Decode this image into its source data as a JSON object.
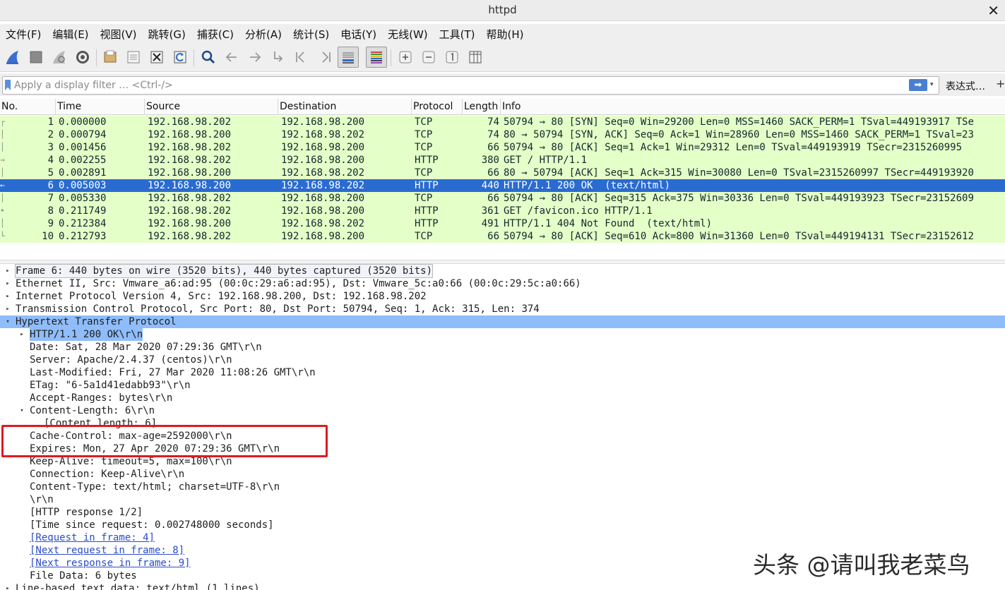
{
  "window": {
    "title": "httpd",
    "close_glyph": "✕"
  },
  "menu": [
    "文件(F)",
    "编辑(E)",
    "视图(V)",
    "跳转(G)",
    "捕获(C)",
    "分析(A)",
    "统计(S)",
    "电话(Y)",
    "无线(W)",
    "工具(T)",
    "帮助(H)"
  ],
  "toolbar": {
    "icons": [
      "shark-fin-start-icon",
      "stop-capture-icon",
      "restart-capture-icon",
      "capture-options-gear-icon",
      "open-file-icon",
      "save-file-icon",
      "close-file-icon",
      "reload-file-icon",
      "find-packet-icon",
      "go-back-icon",
      "go-forward-icon",
      "go-to-packet-icon",
      "first-packet-icon",
      "last-packet-icon",
      "auto-scroll-icon",
      "colorize-icon",
      "zoom-in-icon",
      "zoom-out-icon",
      "normal-size-icon",
      "resize-columns-icon"
    ],
    "pressed": [
      "auto-scroll-icon",
      "colorize-icon"
    ]
  },
  "filter": {
    "placeholder": "Apply a display filter … <Ctrl-/>",
    "value": "",
    "apply_glyph": "➡",
    "dropdown_glyph": "▾",
    "expression_label": "表达式…",
    "add_glyph": "+"
  },
  "packet_list": {
    "columns": [
      "No.",
      "Time",
      "Source",
      "Destination",
      "Protocol",
      "Length",
      "Info"
    ],
    "selected_no": "6",
    "rows": [
      {
        "no": "1",
        "time": "0.000000",
        "src": "192.168.98.202",
        "dst": "192.168.98.200",
        "proto": "TCP",
        "len": "74",
        "info": "50794 → 80 [SYN] Seq=0 Win=29200 Len=0 MSS=1460 SACK_PERM=1 TSval=449193917 TSe",
        "rel": "┌"
      },
      {
        "no": "2",
        "time": "0.000794",
        "src": "192.168.98.200",
        "dst": "192.168.98.202",
        "proto": "TCP",
        "len": "74",
        "info": "80 → 50794 [SYN, ACK] Seq=0 Ack=1 Win=28960 Len=0 MSS=1460 SACK_PERM=1 TSval=23",
        "rel": "│"
      },
      {
        "no": "3",
        "time": "0.001456",
        "src": "192.168.98.202",
        "dst": "192.168.98.200",
        "proto": "TCP",
        "len": "66",
        "info": "50794 → 80 [ACK] Seq=1 Ack=1 Win=29312 Len=0 TSval=449193919 TSecr=2315260995",
        "rel": "│"
      },
      {
        "no": "4",
        "time": "0.002255",
        "src": "192.168.98.202",
        "dst": "192.168.98.200",
        "proto": "HTTP",
        "len": "380",
        "info": "GET / HTTP/1.1",
        "rel": "→"
      },
      {
        "no": "5",
        "time": "0.002891",
        "src": "192.168.98.200",
        "dst": "192.168.98.202",
        "proto": "TCP",
        "len": "66",
        "info": "80 → 50794 [ACK] Seq=1 Ack=315 Win=30080 Len=0 TSval=2315260997 TSecr=449193920",
        "rel": "│"
      },
      {
        "no": "6",
        "time": "0.005003",
        "src": "192.168.98.200",
        "dst": "192.168.98.202",
        "proto": "HTTP",
        "len": "440",
        "info": "HTTP/1.1 200 OK  (text/html)",
        "rel": "←"
      },
      {
        "no": "7",
        "time": "0.005330",
        "src": "192.168.98.202",
        "dst": "192.168.98.200",
        "proto": "TCP",
        "len": "66",
        "info": "50794 → 80 [ACK] Seq=315 Ack=375 Win=30336 Len=0 TSval=449193923 TSecr=23152609",
        "rel": "│"
      },
      {
        "no": "8",
        "time": "0.211749",
        "src": "192.168.98.202",
        "dst": "192.168.98.200",
        "proto": "HTTP",
        "len": "361",
        "info": "GET /favicon.ico HTTP/1.1",
        "rel": "•"
      },
      {
        "no": "9",
        "time": "0.212384",
        "src": "192.168.98.200",
        "dst": "192.168.98.202",
        "proto": "HTTP",
        "len": "491",
        "info": "HTTP/1.1 404 Not Found  (text/html)",
        "rel": "│"
      },
      {
        "no": "10",
        "time": "0.212793",
        "src": "192.168.98.202",
        "dst": "192.168.98.200",
        "proto": "TCP",
        "len": "66",
        "info": "50794 → 80 [ACK] Seq=610 Ack=800 Win=31360 Len=0 TSval=449194131 TSecr=23152612",
        "rel": "└"
      }
    ]
  },
  "details": [
    {
      "text": "Frame 6: 440 bytes on wire (3520 bits), 440 bytes captured (3520 bits)",
      "indent": 0,
      "toggle": "▸",
      "style": "frame"
    },
    {
      "text": "Ethernet II, Src: Vmware_a6:ad:95 (00:0c:29:a6:ad:95), Dst: Vmware_5c:a0:66 (00:0c:29:5c:a0:66)",
      "indent": 0,
      "toggle": "▸",
      "style": ""
    },
    {
      "text": "Internet Protocol Version 4, Src: 192.168.98.200, Dst: 192.168.98.202",
      "indent": 0,
      "toggle": "▸",
      "style": ""
    },
    {
      "text": "Transmission Control Protocol, Src Port: 80, Dst Port: 50794, Seq: 1, Ack: 315, Len: 374",
      "indent": 0,
      "toggle": "▸",
      "style": ""
    },
    {
      "text": "Hypertext Transfer Protocol",
      "indent": 0,
      "toggle": "▾",
      "style": "hl"
    },
    {
      "text": "HTTP/1.1 200 OK\\r\\n",
      "indent": 1,
      "toggle": "▸",
      "style": "hlsub"
    },
    {
      "text": "Date: Sat, 28 Mar 2020 07:29:36 GMT\\r\\n",
      "indent": 1,
      "toggle": "",
      "style": ""
    },
    {
      "text": "Server: Apache/2.4.37 (centos)\\r\\n",
      "indent": 1,
      "toggle": "",
      "style": ""
    },
    {
      "text": "Last-Modified: Fri, 27 Mar 2020 11:08:26 GMT\\r\\n",
      "indent": 1,
      "toggle": "",
      "style": ""
    },
    {
      "text": "ETag: \"6-5a1d41edabb93\"\\r\\n",
      "indent": 1,
      "toggle": "",
      "style": ""
    },
    {
      "text": "Accept-Ranges: bytes\\r\\n",
      "indent": 1,
      "toggle": "",
      "style": ""
    },
    {
      "text": "Content-Length: 6\\r\\n",
      "indent": 1,
      "toggle": "▾",
      "style": ""
    },
    {
      "text": "[Content length: 6]",
      "indent": 2,
      "toggle": "",
      "style": ""
    },
    {
      "text": "Cache-Control: max-age=2592000\\r\\n",
      "indent": 1,
      "toggle": "",
      "style": ""
    },
    {
      "text": "Expires: Mon, 27 Apr 2020 07:29:36 GMT\\r\\n",
      "indent": 1,
      "toggle": "",
      "style": ""
    },
    {
      "text": "Keep-Alive: timeout=5, max=100\\r\\n",
      "indent": 1,
      "toggle": "",
      "style": ""
    },
    {
      "text": "Connection: Keep-Alive\\r\\n",
      "indent": 1,
      "toggle": "",
      "style": ""
    },
    {
      "text": "Content-Type: text/html; charset=UTF-8\\r\\n",
      "indent": 1,
      "toggle": "",
      "style": ""
    },
    {
      "text": "\\r\\n",
      "indent": 1,
      "toggle": "",
      "style": ""
    },
    {
      "text": "[HTTP response 1/2]",
      "indent": 1,
      "toggle": "",
      "style": ""
    },
    {
      "text": "[Time since request: 0.002748000 seconds]",
      "indent": 1,
      "toggle": "",
      "style": ""
    },
    {
      "text": "[Request in frame: 4]",
      "indent": 1,
      "toggle": "",
      "style": "link"
    },
    {
      "text": "[Next request in frame: 8]",
      "indent": 1,
      "toggle": "",
      "style": "link"
    },
    {
      "text": "[Next response in frame: 9]",
      "indent": 1,
      "toggle": "",
      "style": "link"
    },
    {
      "text": "File Data: 6 bytes",
      "indent": 1,
      "toggle": "",
      "style": ""
    },
    {
      "text": "Line-based text data: text/html (1 lines)",
      "indent": 0,
      "toggle": "▸",
      "style": ""
    }
  ],
  "watermark": "头条 @请叫我老菜鸟",
  "colors": {
    "tcp_row": "#e4ffc7",
    "selected_row": "#2a6bd1",
    "detail_highlight": "#8fbdfa",
    "annotation_box": "#e0191f"
  }
}
